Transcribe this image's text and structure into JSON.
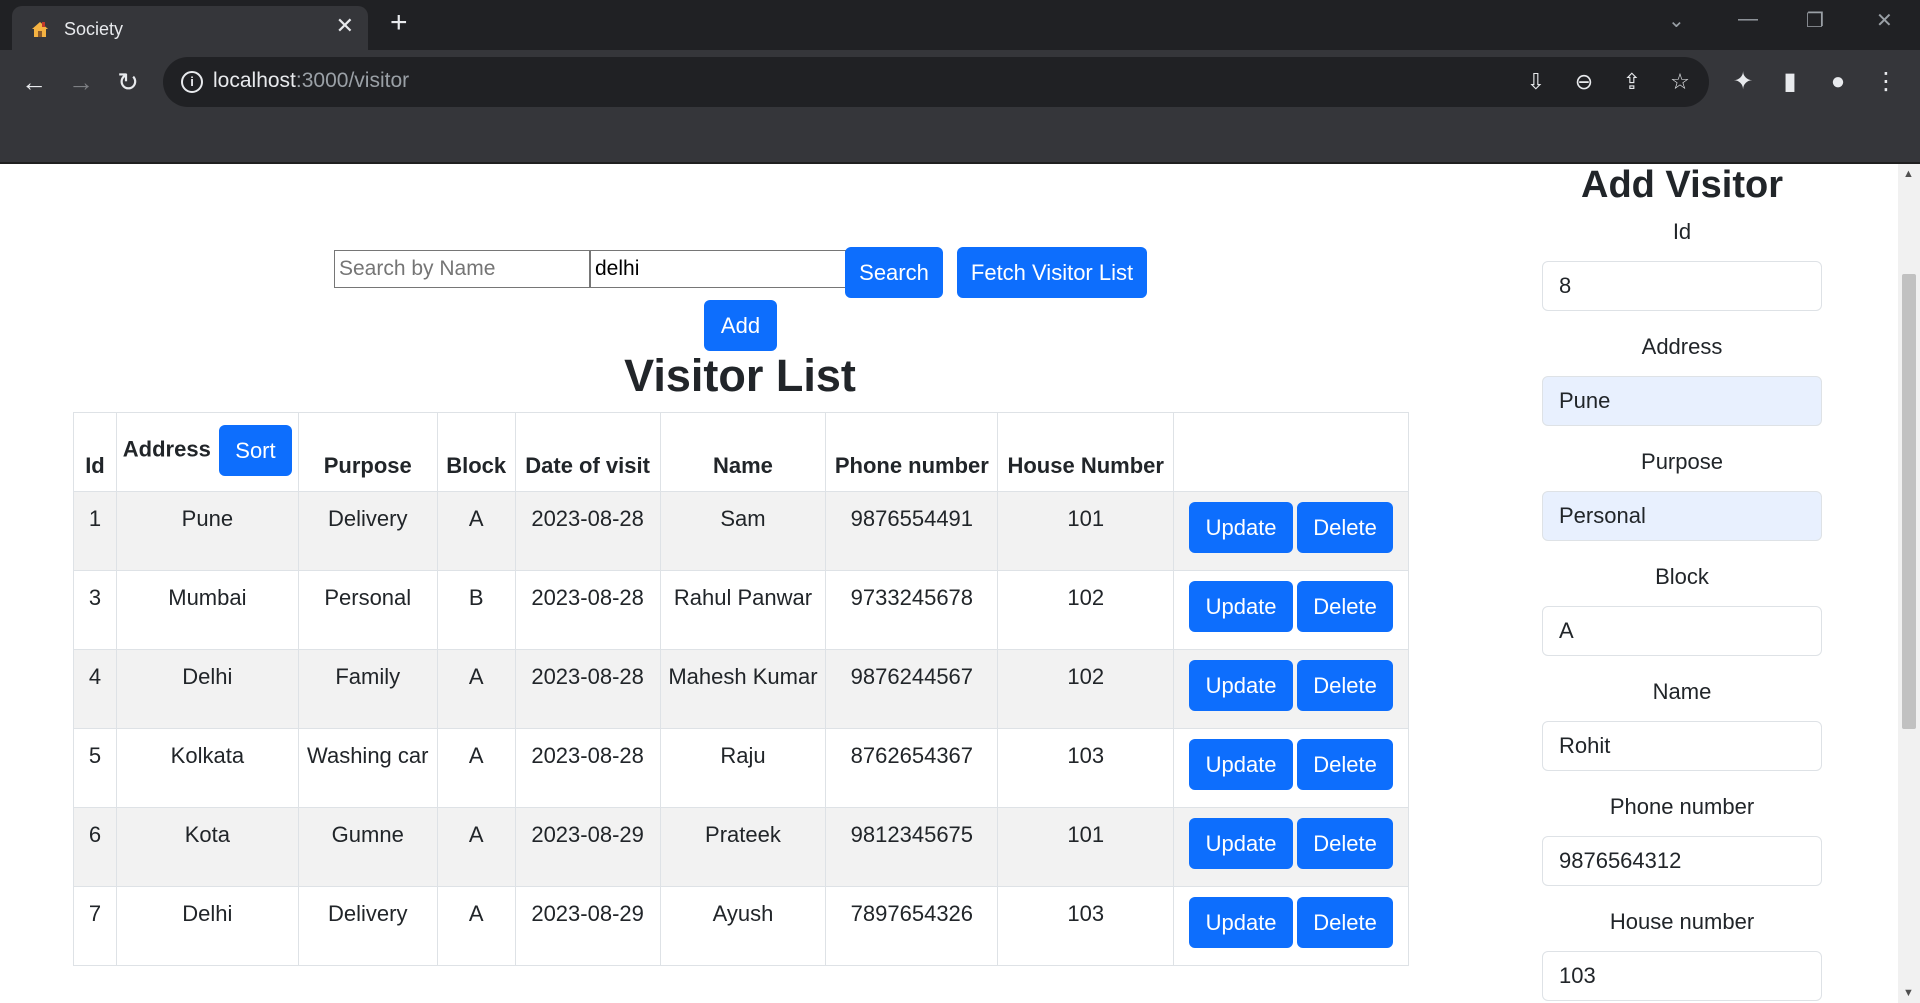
{
  "browser": {
    "tab_title": "Society",
    "url_host": "localhost",
    "url_path": ":3000/visitor"
  },
  "search": {
    "name_placeholder": "Search by Name",
    "address_value": "delhi",
    "search_label": "Search",
    "fetch_label": "Fetch Visitor List",
    "add_label": "Add"
  },
  "title": "Visitor List",
  "table": {
    "headers": {
      "id": "Id",
      "address": "Address",
      "sort": "Sort",
      "purpose": "Purpose",
      "block": "Block",
      "date": "Date of visit",
      "name": "Name",
      "phone": "Phone number",
      "house": "House Number"
    },
    "update_label": "Update",
    "delete_label": "Delete",
    "rows": [
      {
        "id": "1",
        "address": "Pune",
        "purpose": "Delivery",
        "block": "A",
        "date": "2023-08-28",
        "name": "Sam",
        "phone": "9876554491",
        "house": "101"
      },
      {
        "id": "3",
        "address": "Mumbai",
        "purpose": "Personal",
        "block": "B",
        "date": "2023-08-28",
        "name": "Rahul Panwar",
        "phone": "9733245678",
        "house": "102"
      },
      {
        "id": "4",
        "address": "Delhi",
        "purpose": "Family",
        "block": "A",
        "date": "2023-08-28",
        "name": "Mahesh Kumar",
        "phone": "9876244567",
        "house": "102"
      },
      {
        "id": "5",
        "address": "Kolkata",
        "purpose": "Washing car",
        "block": "A",
        "date": "2023-08-28",
        "name": "Raju",
        "phone": "8762654367",
        "house": "103"
      },
      {
        "id": "6",
        "address": "Kota",
        "purpose": "Gumne",
        "block": "A",
        "date": "2023-08-29",
        "name": "Prateek",
        "phone": "9812345675",
        "house": "101"
      },
      {
        "id": "7",
        "address": "Delhi",
        "purpose": "Delivery",
        "block": "A",
        "date": "2023-08-29",
        "name": "Ayush",
        "phone": "7897654326",
        "house": "103"
      }
    ]
  },
  "form": {
    "title": "Add Visitor",
    "fields": [
      {
        "label": "Id",
        "value": "8"
      },
      {
        "label": "Address",
        "value": "Pune"
      },
      {
        "label": "Purpose",
        "value": "Personal"
      },
      {
        "label": "Block",
        "value": "A"
      },
      {
        "label": "Name",
        "value": "Rohit"
      },
      {
        "label": "Phone number",
        "value": "9876564312"
      },
      {
        "label": "House number",
        "value": "103"
      }
    ]
  },
  "colors": {
    "primary": "#0d6efd",
    "autofill": "#e8f0fe",
    "chrome_dark": "#202124",
    "chrome_toolbar": "#35363a"
  }
}
